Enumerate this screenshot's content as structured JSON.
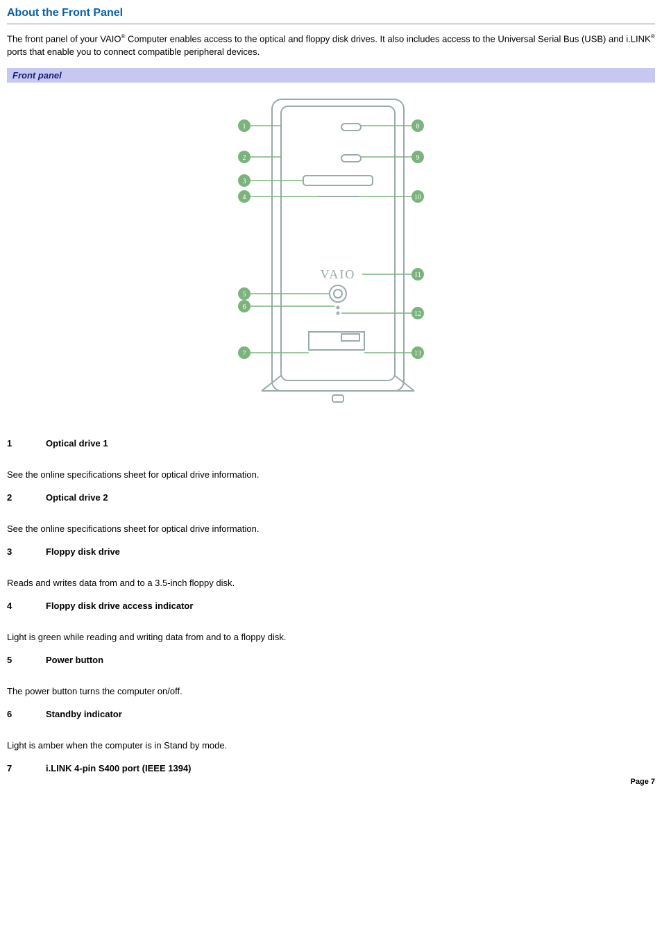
{
  "title": "About the Front Panel",
  "intro_1a": "The front panel of your VAIO",
  "intro_1b": " Computer enables access to the optical and floppy disk drives. It also includes access to the Universal Serial Bus (USB) and i.LINK",
  "intro_1c": " ports that enable you to connect compatible peripheral devices.",
  "reg": "®",
  "figure_caption": "Front panel",
  "items": [
    {
      "num": "1",
      "label": "Optical drive 1",
      "desc": "See the online specifications sheet for optical drive information."
    },
    {
      "num": "2",
      "label": "Optical drive 2",
      "desc": "See the online specifications sheet for optical drive information."
    },
    {
      "num": "3",
      "label": "Floppy disk drive",
      "desc": "Reads and writes data from and to a 3.5-inch floppy disk."
    },
    {
      "num": "4",
      "label": "Floppy disk drive access indicator",
      "desc": "Light is green while reading and writing data from and to a floppy disk."
    },
    {
      "num": "5",
      "label": "Power button",
      "desc": "The power button turns the computer on/off."
    },
    {
      "num": "6",
      "label": "Standby indicator",
      "desc": "Light is amber when the computer is in Stand by mode."
    },
    {
      "num": "7",
      "label": "i.LINK 4-pin S400 port (IEEE 1394)",
      "desc": ""
    }
  ],
  "page_footer": "Page 7",
  "diagram_callouts": [
    "1",
    "2",
    "3",
    "4",
    "5",
    "6",
    "7",
    "8",
    "9",
    "10",
    "11",
    "12",
    "13"
  ],
  "vaio_logo_text": "VAIO"
}
